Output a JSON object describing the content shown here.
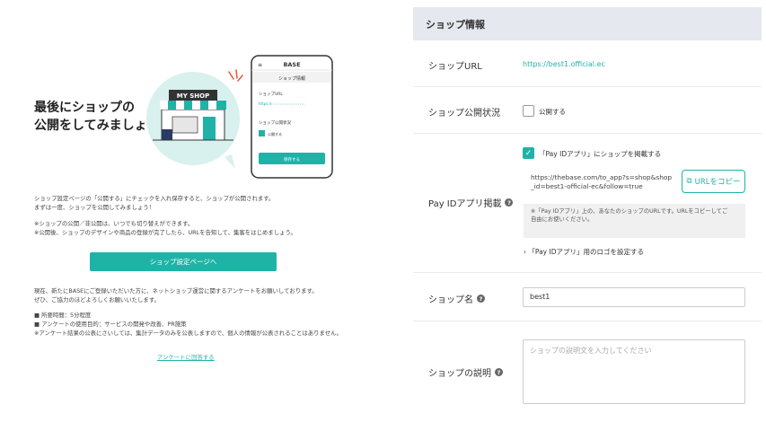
{
  "left": {
    "title_line1": "最後にショップの",
    "title_line2": "公開をしてみましょう！",
    "illustration": {
      "shop_sign": "MY SHOP",
      "phone_brand": "BASE",
      "phone_header": "ショップ情報",
      "phone_url_label": "ショップURL",
      "phone_url_value": "https://",
      "phone_status_label": "ショップ公開状況",
      "phone_check_label": "公開する",
      "phone_save_button": "保存する"
    },
    "desc1_line1": "ショップ設定ページの「公開する」にチェックを入れ保存すると、ショップが公開されます。",
    "desc1_line2": "まずは一度、ショップを公開してみましょう！",
    "desc2_line1": "※ショップの公開／非公開は、いつでも切り替えができます。",
    "desc2_line2": "※公開後、ショップのデザインや商品の登録が完了したら、URLを告知して、集客をはじめましょう。",
    "cta_label": "ショップ設定ページへ",
    "survey_line1": "現在、新たにBASEにご登録いただいた方に、ネットショップ運営に関するアンケートをお願いしております。",
    "survey_line2": "ぜひ、ご協力のほどよろしくお願いいたします。",
    "bullet1": "■ 所要時間：5分程度",
    "bullet2": "■ アンケートの使用目的：サービスの開発や改善、PR施策",
    "bullet3": "※アンケート結果の公表にさいしては、集計データのみを公表しますので、個人の情報が公表されることはありません。",
    "survey_link": "アンケートに回答する"
  },
  "right": {
    "header": "ショップ情報",
    "url_label": "ショップURL",
    "url_value": "https://best1.official.ec",
    "status_label": "ショップ公開状況",
    "status_checkbox_label": "公開する",
    "status_checked": false,
    "payid_label": "Pay IDアプリ掲載",
    "payid_checkbox_label": "「Pay IDアプリ」にショップを掲載する",
    "payid_checked": true,
    "payid_url_line1": "https://thebase.com/to_app?s=shop&shop",
    "payid_url_line2": "_id=best1-official-ec&follow=true",
    "copy_button": "URLをコピー",
    "note_line1": "※「Pay IDアプリ」上の、あなたのショップのURLです。URLをコピーしてご",
    "note_line2": "自由にお使いください。",
    "logo_link": "「Pay IDアプリ」用のロゴを設定する",
    "name_label": "ショップ名",
    "name_value": "best1",
    "desc_label": "ショップの説明",
    "desc_placeholder": "ショップの説明文を入力してください",
    "help_icon": "?"
  },
  "colors": {
    "accent": "#1fb3a7",
    "header_bg": "#e5e8ee"
  }
}
